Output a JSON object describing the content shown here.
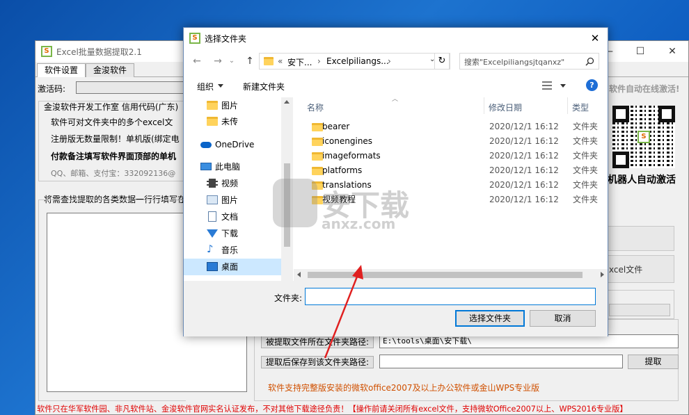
{
  "main_window": {
    "title": "Excel批量数据提取2.1",
    "icon_letter": "S",
    "controls": [
      "—",
      "☐",
      "✕"
    ],
    "tabs": [
      {
        "label": "软件设置"
      },
      {
        "label": "金浚软件"
      }
    ],
    "activation_label": "激活码:",
    "activation_right": "软件自动在线激活!",
    "info_lines": [
      "金浚软件开发工作室 信用代码(广东)",
      "软件可对文件夹中的多个excel文",
      "注册版无数量限制！单机版(绑定电",
      "付款备注填写软件界面顶部的单机",
      "QQ、邮箱、支付宝：332092136@"
    ],
    "extract_prompt": "将需查找提取的各类数据一行行填写在",
    "qr_caption": "机器人自动激活",
    "side_text": "xcel文件",
    "source_path_label": "被提取文件所在文件夹路径:",
    "source_path_value": "E:\\tools\\桌面\\安下载\\",
    "save_path_label": "提取后保存到该文件夹路径:",
    "save_path_value": "",
    "extract_button": "提取",
    "support_note": "软件支持完整版安装的微软office2007及以上办公软件或金山WPS专业版",
    "footer_note": "软件只在华军软件园、非凡软件站、金浚软件官网实名认证发布，不对其他下载途径负责！【操作前请关闭所有excel文件，支持微软Office2007以上、WPS2016专业版】"
  },
  "dialog": {
    "title": "选择文件夹",
    "close": "✕",
    "nav": {
      "back": "←",
      "forward": "→",
      "dropdown": "⌄",
      "up": "↑",
      "refresh": "↻"
    },
    "breadcrumb": [
      "«",
      "安下...",
      "›",
      "Excelpiliangs...",
      "›"
    ],
    "search_placeholder": "搜索\"Excelpiliangsjtqanxz\"",
    "toolbar": {
      "organize": "组织",
      "new_folder": "新建文件夹",
      "help": "?"
    },
    "sidebar": [
      {
        "label": "图片",
        "icon": "folder-icon"
      },
      {
        "label": "未传",
        "icon": "folder-icon"
      },
      {
        "label": "OneDrive",
        "icon": "cloud-icon"
      },
      {
        "label": "此电脑",
        "icon": "computer-icon"
      },
      {
        "label": "视频",
        "icon": "video-icon"
      },
      {
        "label": "图片",
        "icon": "picture-icon"
      },
      {
        "label": "文档",
        "icon": "document-icon"
      },
      {
        "label": "下载",
        "icon": "download-icon"
      },
      {
        "label": "音乐",
        "icon": "music-icon"
      },
      {
        "label": "桌面",
        "icon": "desktop-icon"
      }
    ],
    "columns": {
      "name": "名称",
      "date": "修改日期",
      "type": "类型"
    },
    "files": [
      {
        "name": "bearer",
        "date": "2020/12/1 16:12",
        "type": "文件夹"
      },
      {
        "name": "iconengines",
        "date": "2020/12/1 16:12",
        "type": "文件夹"
      },
      {
        "name": "imageformats",
        "date": "2020/12/1 16:12",
        "type": "文件夹"
      },
      {
        "name": "platforms",
        "date": "2020/12/1 16:12",
        "type": "文件夹"
      },
      {
        "name": "translations",
        "date": "2020/12/1 16:12",
        "type": "文件夹"
      },
      {
        "name": "视频教程",
        "date": "2020/12/1 16:12",
        "type": "文件夹"
      }
    ],
    "folder_label": "文件夹:",
    "folder_value": "",
    "select_button": "选择文件夹",
    "cancel_button": "取消"
  },
  "watermark": {
    "text": "安下载",
    "subtext": "anxz.com"
  },
  "colors": {
    "accent": "#0078d7",
    "red": "#e00000",
    "orange": "#d05000",
    "arrow": "#e02020"
  }
}
